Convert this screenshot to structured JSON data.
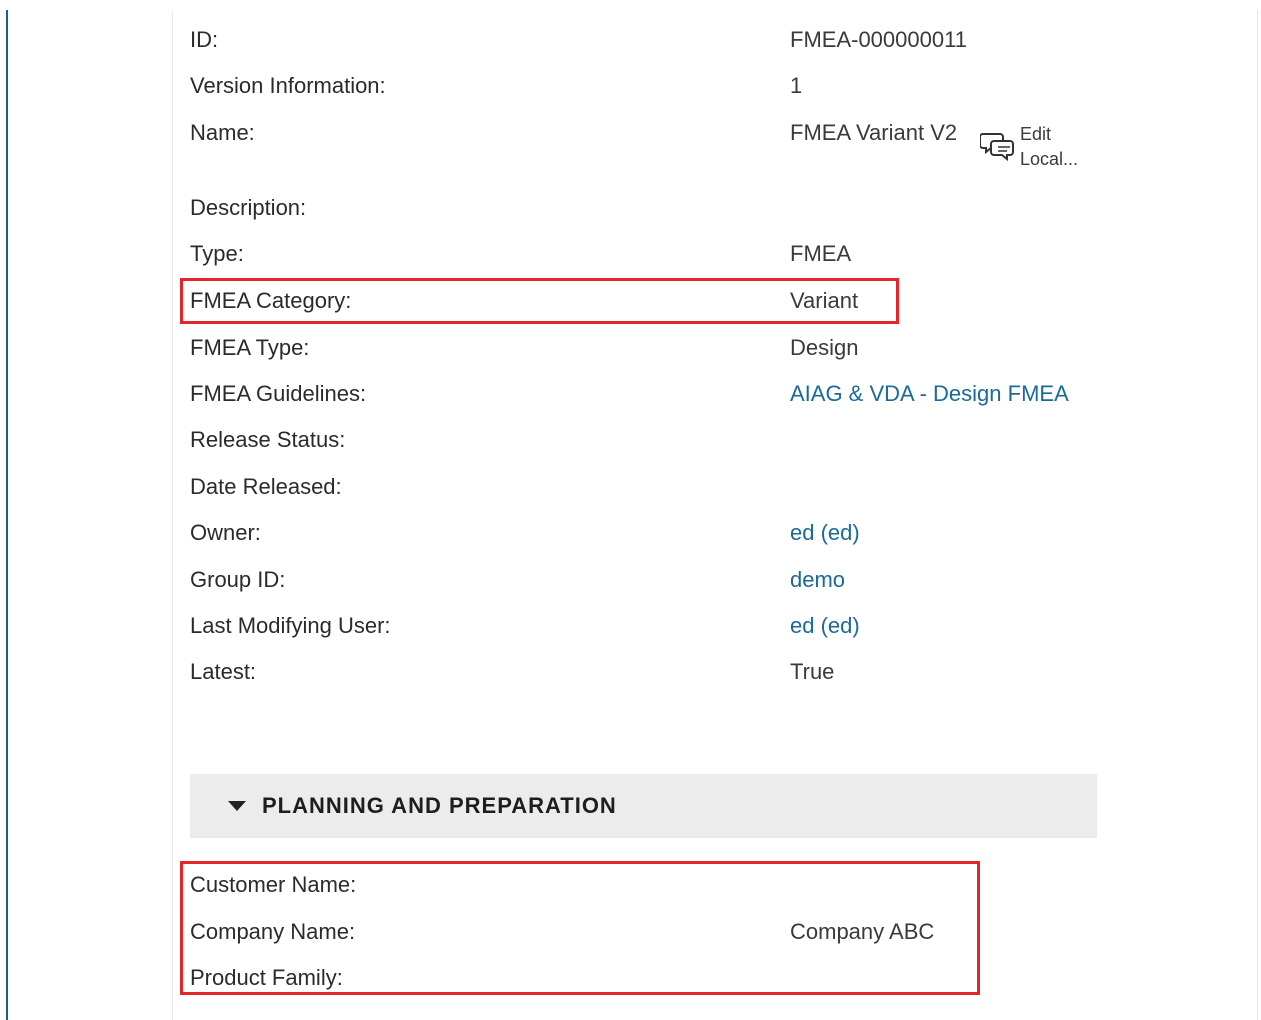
{
  "fields": [
    {
      "label": "ID:",
      "value": "FMEA-000000011",
      "link": false
    },
    {
      "label": "Version Information:",
      "value": "1",
      "link": false
    },
    {
      "label": "Name:",
      "value": "FMEA Variant V2",
      "link": false
    },
    {
      "label": "Description:",
      "value": "",
      "link": false
    },
    {
      "label": "Type:",
      "value": "FMEA",
      "link": false
    },
    {
      "label": "FMEA Category:",
      "value": "Variant",
      "link": false
    },
    {
      "label": "FMEA Type:",
      "value": "Design",
      "link": false
    },
    {
      "label": "FMEA Guidelines:",
      "value": "AIAG & VDA - Design FMEA",
      "link": true
    },
    {
      "label": "Release Status:",
      "value": "",
      "link": false
    },
    {
      "label": "Date Released:",
      "value": "",
      "link": false
    },
    {
      "label": "Owner:",
      "value": "ed (ed)",
      "link": true
    },
    {
      "label": "Group ID:",
      "value": "demo",
      "link": true
    },
    {
      "label": "Last Modifying User:",
      "value": "ed (ed)",
      "link": true
    },
    {
      "label": "Latest:",
      "value": "True",
      "link": false
    }
  ],
  "edit_local": {
    "line1": "Edit",
    "line2": "Local...",
    "icon": "chat-bubbles-icon"
  },
  "section": {
    "title": "PLANNING AND PREPARATION",
    "icon": "caret-down-icon",
    "fields": [
      {
        "label": "Customer Name:",
        "value": ""
      },
      {
        "label": "Company Name:",
        "value": "Company ABC"
      },
      {
        "label": "Product Family:",
        "value": ""
      }
    ]
  },
  "colors": {
    "highlight": "#e3262b",
    "link": "#1a6a9a",
    "section_bg": "#ececec"
  }
}
